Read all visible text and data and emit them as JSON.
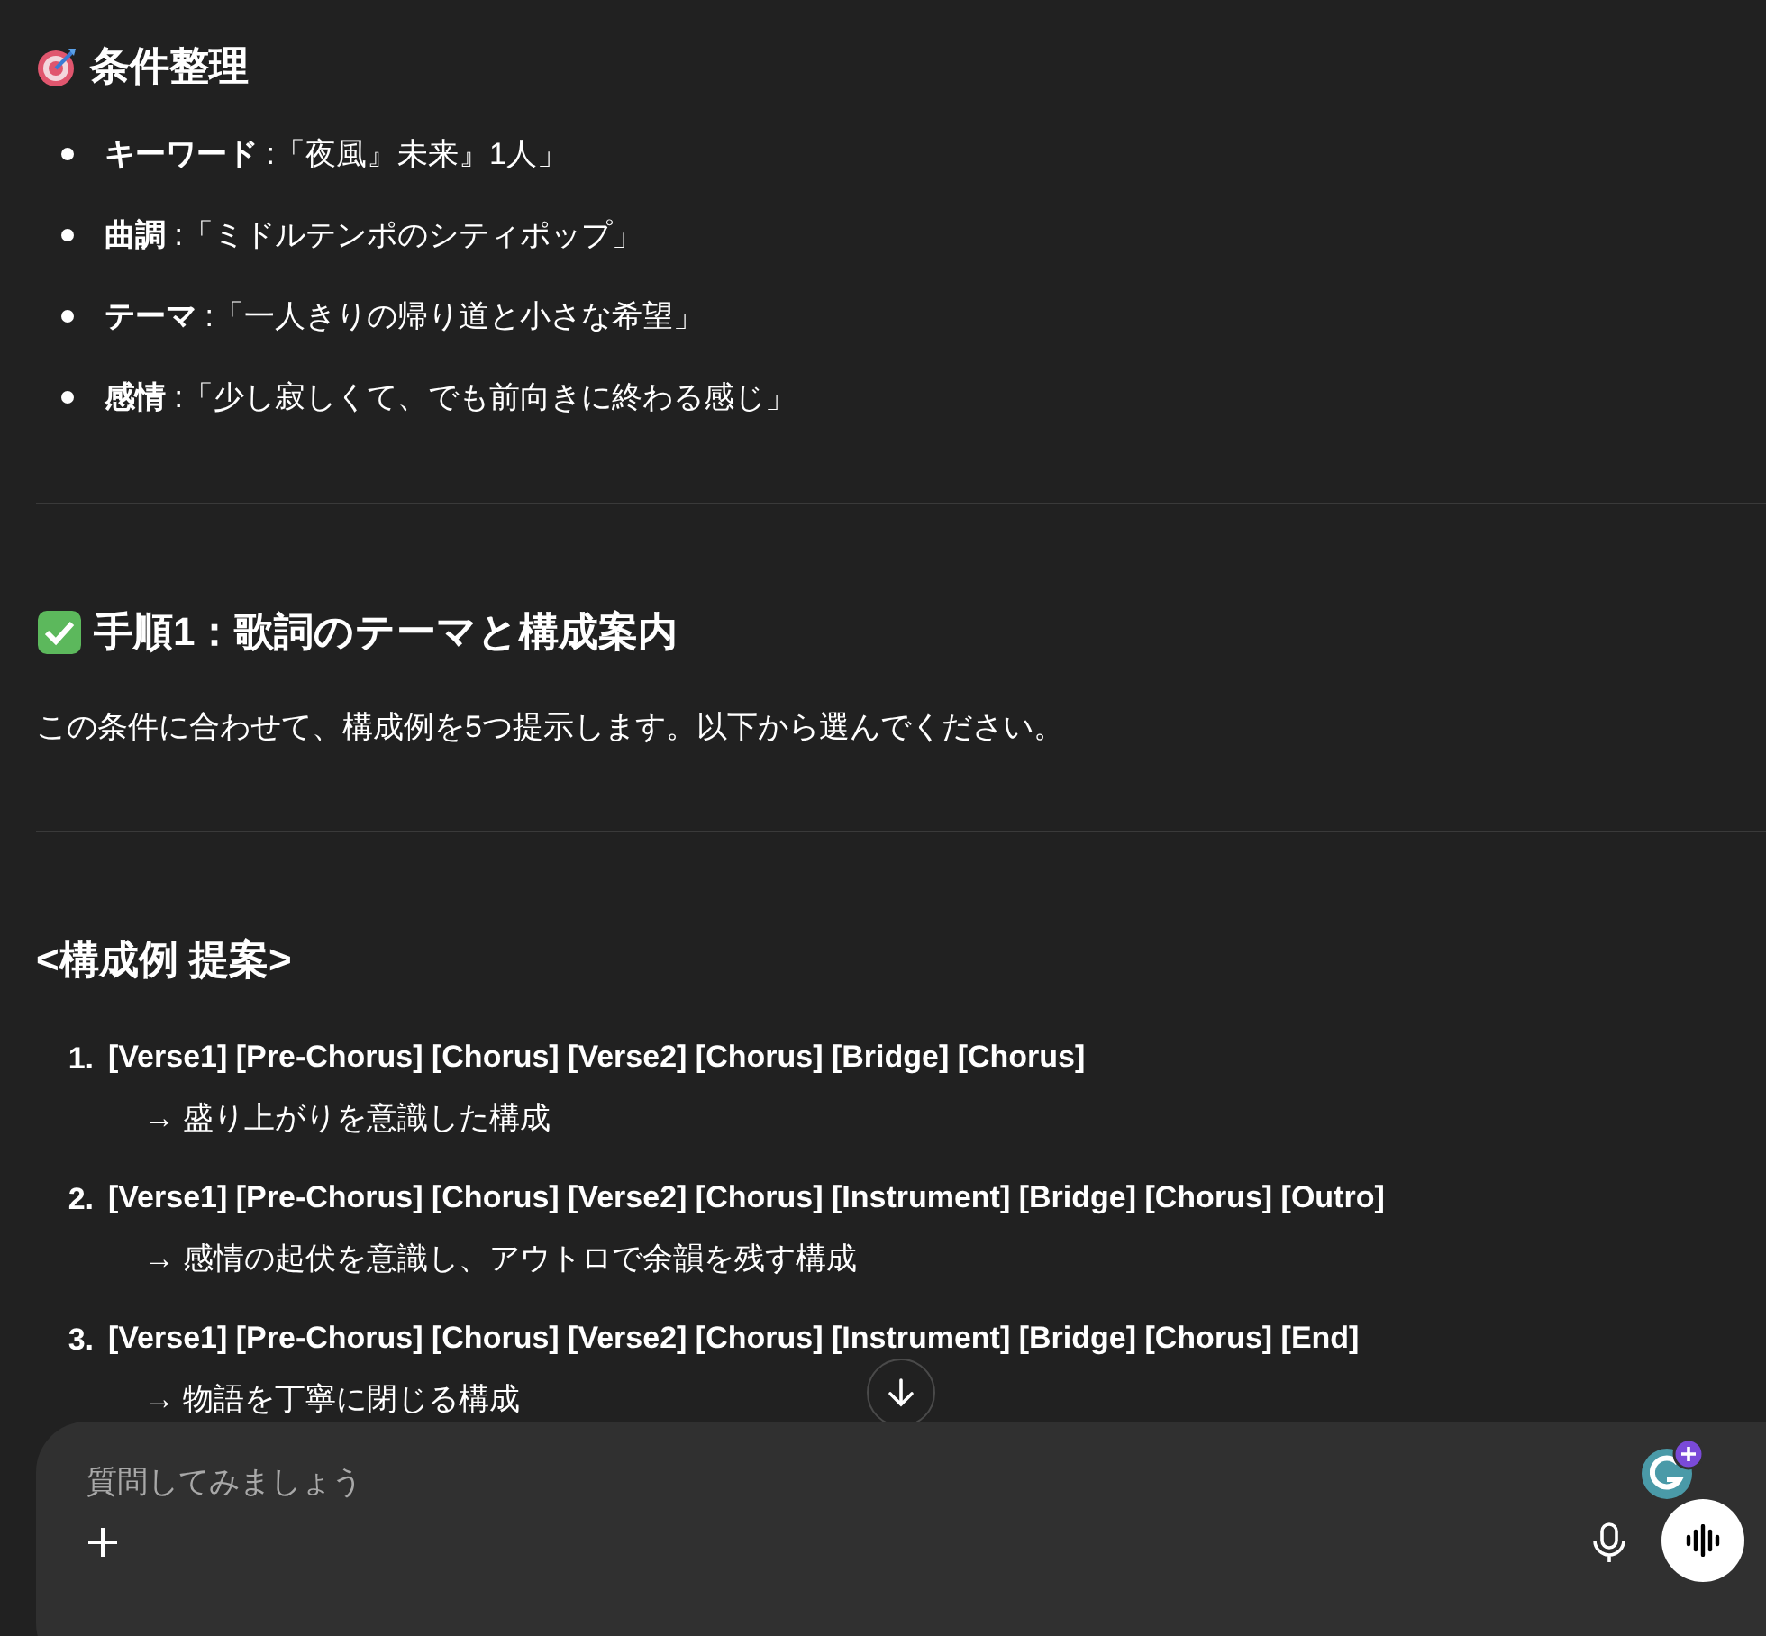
{
  "sections": [
    {
      "kind": "bullets",
      "heading": "条件整理",
      "items": [
        {
          "text": "**キーワード** :「夜風』未来』1人」"
        },
        {
          "text": "**曲調** :「ミドルテンポのシティポップ」"
        },
        {
          "text": "**テーマ** :「一人きりの帰り道と小さな希望」"
        },
        {
          "text": "**感情** :「少し寂しくて、でも前向きに終わる感じ」"
        }
      ]
    },
    {
      "kind": "paragraph",
      "heading": "手順1：歌詞のテーマと構成案内",
      "text": "この条件に合わせて、構成例を5つ提示します。以下から選んでください。"
    },
    {
      "kind": "numbered",
      "heading": "<構成例 提案>",
      "items": [
        {
          "number": "1.",
          "title": "[Verse1] [Pre-Chorus] [Chorus] [Verse2] [Chorus] [Bridge] [Chorus]",
          "note": "→ 盛り上がりを意識した構成"
        },
        {
          "number": "2.",
          "title": "[Verse1] [Pre-Chorus] [Chorus] [Verse2] [Chorus] [Instrument] [Bridge] [Chorus] [Outro]",
          "note": "→ 感情の起伏を意識し、アウトロで余韻を残す構成"
        },
        {
          "number": "3.",
          "title": "[Verse1] [Pre-Chorus] [Chorus] [Verse2] [Chorus] [Instrument] [Bridge] [Chorus] [End]",
          "note": "→ 物語を丁寧に閉じる構成"
        }
      ]
    }
  ],
  "composer": {
    "placeholder": "質問してみましょう"
  }
}
